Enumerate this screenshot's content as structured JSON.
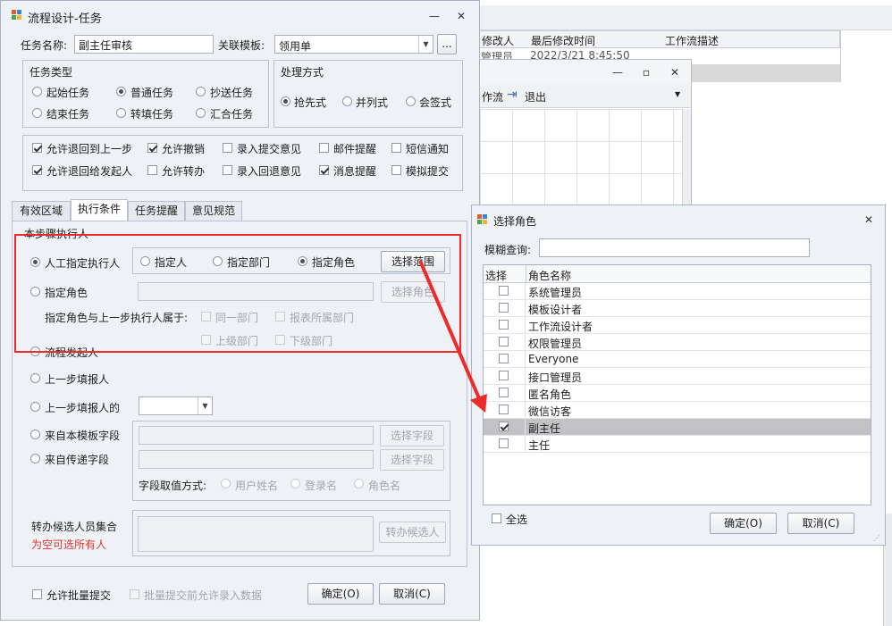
{
  "bg_window": {
    "columns": [
      "修改人",
      "最后修改时间",
      "工作流描述"
    ],
    "row1": [
      "管理员",
      "2022/3/21 8:45:50"
    ]
  },
  "sub_window": {
    "toolbar": {
      "workflow_label": "作流",
      "exit_label": "退出"
    }
  },
  "main_window": {
    "title": "流程设计-任务",
    "task_name_label": "任务名称:",
    "task_name_value": "副主任审核",
    "template_label": "关联模板:",
    "template_value": "领用单",
    "browse_label": "...",
    "task_type": {
      "title": "任务类型",
      "options": [
        {
          "label": "起始任务",
          "checked": false
        },
        {
          "label": "普通任务",
          "checked": true
        },
        {
          "label": "抄送任务",
          "checked": false
        },
        {
          "label": "结束任务",
          "checked": false
        },
        {
          "label": "转填任务",
          "checked": false
        },
        {
          "label": "汇合任务",
          "checked": false
        }
      ]
    },
    "process_mode": {
      "title": "处理方式",
      "options": [
        {
          "label": "抢先式",
          "checked": true
        },
        {
          "label": "并列式",
          "checked": false
        },
        {
          "label": "会签式",
          "checked": false
        }
      ]
    },
    "options": [
      {
        "label": "允许退回到上一步",
        "checked": true
      },
      {
        "label": "允许撤销",
        "checked": true
      },
      {
        "label": "录入提交意见",
        "checked": false
      },
      {
        "label": "邮件提醒",
        "checked": false
      },
      {
        "label": "短信通知",
        "checked": false
      },
      {
        "label": "允许退回给发起人",
        "checked": true
      },
      {
        "label": "允许转办",
        "checked": false
      },
      {
        "label": "录入回退意见",
        "checked": false
      },
      {
        "label": "消息提醒",
        "checked": true
      },
      {
        "label": "模拟提交",
        "checked": false
      }
    ],
    "tabs": [
      "有效区域",
      "执行条件",
      "任务提醒",
      "意见规范"
    ],
    "exec": {
      "group_title": "本步骤执行人",
      "manual_label": "人工指定执行人",
      "assign_person": "指定人",
      "assign_dept": "指定部门",
      "assign_role": "指定角色",
      "select_range_button": "选择范围",
      "role_label": "指定角色",
      "select_role_button": "选择角色",
      "belongs_label": "指定角色与上一步执行人属于:",
      "same_dept": "同一部门",
      "report_dept": "报表所属部门",
      "upper_dept": "上级部门",
      "lower_dept": "下级部门",
      "initiator": "流程发起人",
      "prev_filler": "上一步填报人",
      "prev_filler_of": "上一步填报人的",
      "from_template_field": "来自本模板字段",
      "from_passed_field": "来自传递字段",
      "select_field_button": "选择字段",
      "field_value_mode": "字段取值方式:",
      "user_name": "用户姓名",
      "login_name": "登录名",
      "role_name": "角色名",
      "transfer_label": "转办候选人员集合",
      "transfer_hint": "为空可选所有人",
      "transfer_button": "转办候选人"
    },
    "footer": {
      "batch_submit": "允许批量提交",
      "batch_allow_input": "批量提交前允许录入数据",
      "ok": "确定(O)",
      "cancel": "取消(C)"
    }
  },
  "role_dialog": {
    "title": "选择角色",
    "search_label": "模糊查询:",
    "search_value": "",
    "col_select": "选择",
    "col_name": "角色名称",
    "rows": [
      {
        "name": "系统管理员",
        "checked": false
      },
      {
        "name": "模板设计者",
        "checked": false
      },
      {
        "name": "工作流设计者",
        "checked": false
      },
      {
        "name": "权限管理员",
        "checked": false
      },
      {
        "name": "Everyone",
        "checked": false
      },
      {
        "name": "接口管理员",
        "checked": false
      },
      {
        "name": "匿名角色",
        "checked": false
      },
      {
        "name": "微信访客",
        "checked": false
      },
      {
        "name": "副主任",
        "checked": true
      },
      {
        "name": "主任",
        "checked": false
      }
    ],
    "select_all": "全选",
    "ok": "确定(O)",
    "cancel": "取消(C)"
  },
  "colors": {
    "annotation_red": "#ee2b2b",
    "selected_row": "#c2c2c4"
  }
}
